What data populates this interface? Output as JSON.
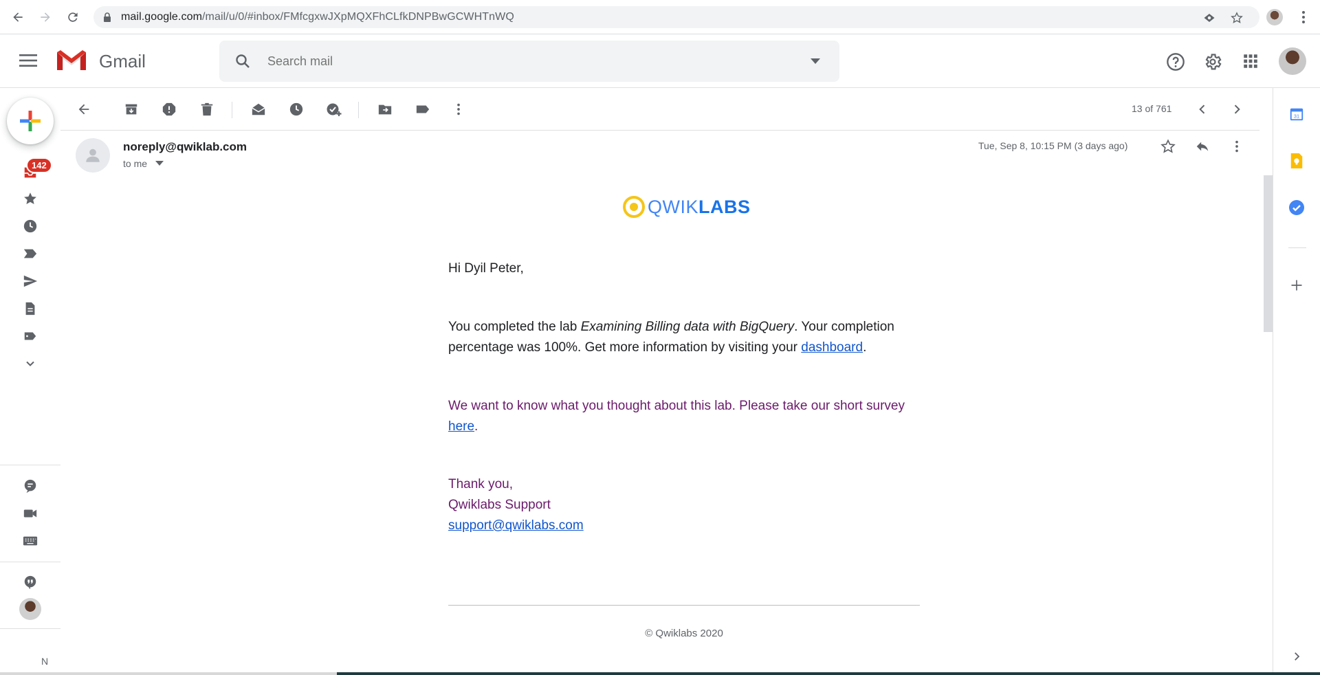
{
  "browser": {
    "url_host": "mail.google.com",
    "url_path": "/mail/u/0/#inbox/FMfcgxwJXpMQXFhCLfkDNPBwGCWHTnWQ"
  },
  "header": {
    "app_name": "Gmail",
    "search_placeholder": "Search mail"
  },
  "rail": {
    "inbox_badge": "142",
    "bottom_letter": "N"
  },
  "toolbar": {
    "pager": "13 of 761"
  },
  "message": {
    "sender": "noreply@qwiklab.com",
    "recipient": "to me",
    "date": "Tue, Sep 8, 10:15 PM (3 days ago)"
  },
  "email": {
    "logo_part1": "QWIK",
    "logo_part2": "LABS",
    "greeting": "Hi Dyil Peter,",
    "p1_before": "You completed the lab ",
    "p1_lab": "Examining Billing data with BigQuery",
    "p1_after": ". Your completion percentage was 100%. Get more information by visiting your ",
    "p1_link": "dashboard",
    "p1_end": ".",
    "p2_before": "We want to know what you thought about this lab. Please take our short survey ",
    "p2_link": "here",
    "p2_end": ".",
    "signoff": "Thank you,",
    "signature": "Qwiklabs Support",
    "support_email": "support@qwiklabs.com",
    "footer": "© Qwiklabs 2020"
  },
  "colors": {
    "accent_link": "#1155cc",
    "purple_text": "#6b1b6b",
    "badge_red": "#d93025",
    "qwiklabs_yellow": "#f5c518",
    "qwiklabs_blue": "#1a73e8"
  }
}
